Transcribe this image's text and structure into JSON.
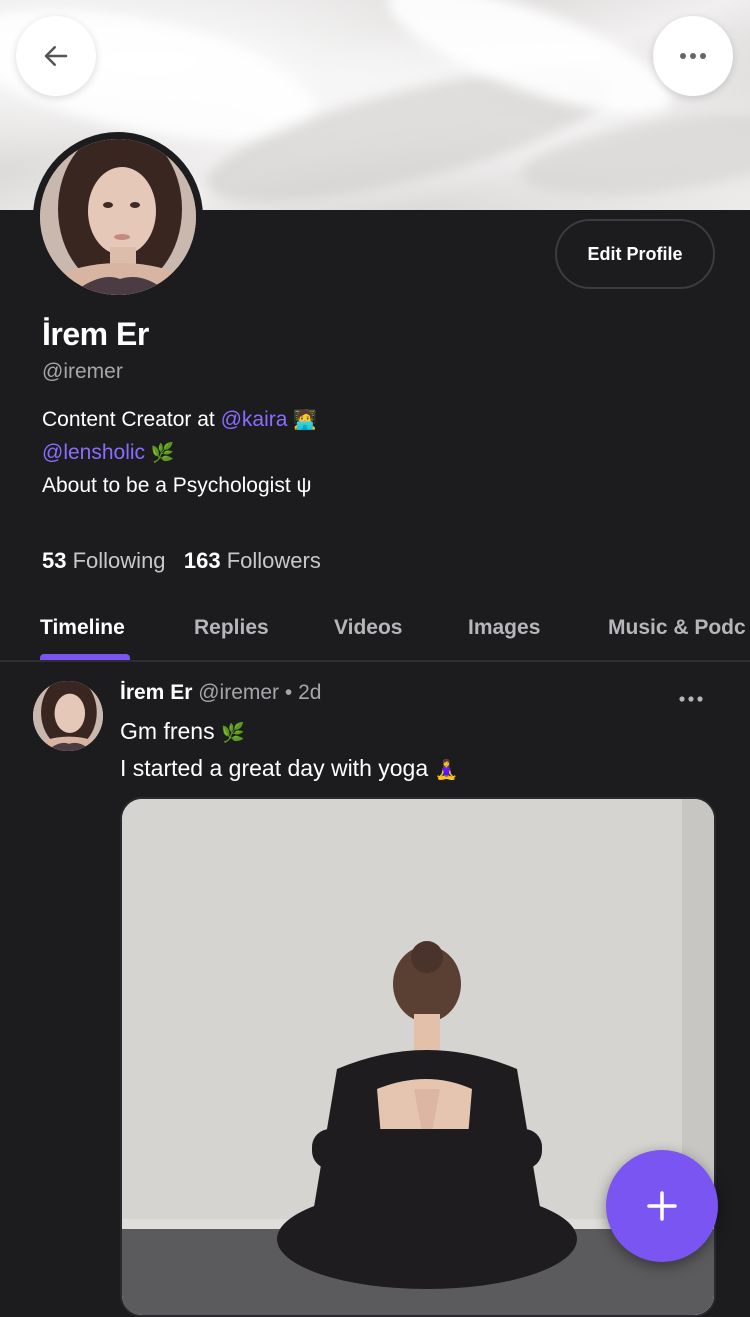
{
  "header": {
    "back_icon": "arrow-left-icon",
    "more_icon": "more-horizontal-icon"
  },
  "profile": {
    "name": "İrem Er",
    "handle": "@iremer",
    "edit_label": "Edit Profile",
    "bio": {
      "line1_prefix": "Content Creator at ",
      "line1_link": "@kaira",
      "line1_emoji": "🧑‍💻",
      "line2_link": "@lensholic",
      "line2_emoji": "🌿",
      "line3": "About to be a Psychologist ψ"
    },
    "following_count": "53",
    "following_label": "Following",
    "followers_count": "163",
    "followers_label": "Followers"
  },
  "tabs": [
    {
      "label": "Timeline",
      "active": true
    },
    {
      "label": "Replies"
    },
    {
      "label": "Videos"
    },
    {
      "label": "Images"
    },
    {
      "label": "Music & Podc"
    }
  ],
  "post": {
    "author_name": "İrem Er",
    "author_handle": "@iremer",
    "separator": "•",
    "time": "2d",
    "line1": "Gm frens",
    "line1_emoji": "🌿",
    "line2": "I started a great day with yoga",
    "line2_emoji": "🧘‍♀️"
  },
  "fab": {
    "icon": "plus-icon"
  },
  "colors": {
    "accent": "#7a55f2",
    "link": "#8a6cff",
    "background": "#1c1c1e"
  }
}
